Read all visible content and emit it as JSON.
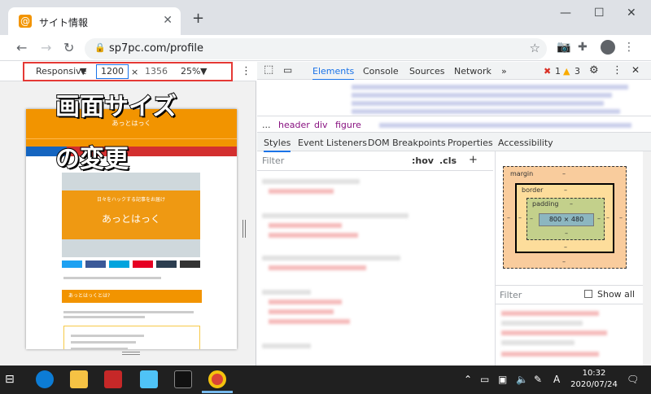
{
  "tab": {
    "title": "サイト情報",
    "favicon": "@"
  },
  "address": {
    "url": "sp7pc.com/profile"
  },
  "device": {
    "mode": "Responsive",
    "width": "1200",
    "times": "×",
    "height": "1356",
    "zoom": "25%"
  },
  "overlay": {
    "line1": "画面サイズ",
    "line2": "の変更"
  },
  "site": {
    "title": "あっとはっく",
    "hero_sub": "日々をハックする記事をお届け",
    "hero_main": "あっとはっく",
    "section": "あっとはっくとは?"
  },
  "devtools": {
    "tabs": [
      "Elements",
      "Console",
      "Sources",
      "Network",
      "»"
    ],
    "errors": "1",
    "warnings": "3",
    "breadcrumbs": [
      "...",
      "header",
      "div",
      "figure"
    ],
    "style_tabs": [
      "Styles",
      "Event Listeners",
      "DOM Breakpoints",
      "Properties",
      "Accessibility"
    ],
    "filter_placeholder": "Filter",
    "hov": ":hov",
    "cls": ".cls",
    "plus": "+",
    "box": {
      "margin": "margin",
      "border": "border",
      "padding": "padding",
      "content": "800 × 480",
      "dash": "–"
    },
    "filter2": "Filter",
    "show_all": "Show all"
  },
  "clock": {
    "time": "10:32",
    "date": "2020/07/24"
  },
  "tray": {
    "ime": "A"
  },
  "colors": {
    "accent": "#1a73e8",
    "site_orange": "#f29400",
    "highlight_red": "#e53935"
  }
}
